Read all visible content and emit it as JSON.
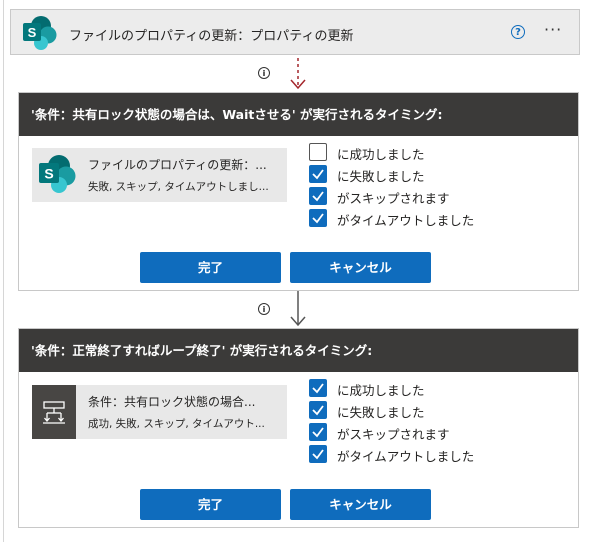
{
  "action": {
    "title": "ファイルのプロパティの更新：プロパティの更新",
    "help_glyph": "?",
    "more_glyph": "···",
    "icon": "sharepoint-icon"
  },
  "info_glyph": "i",
  "panels": [
    {
      "header": "'条件：共有ロック状態の場合は、Waitさせる' が実行されるタイミング:",
      "source": {
        "icon": "sharepoint-icon",
        "name": "ファイルのプロパティの更新：...",
        "status": "失敗, スキップ, タイムアウトしまし..."
      },
      "checkboxes": [
        {
          "label": "に成功しました",
          "checked": false
        },
        {
          "label": "に失敗しました",
          "checked": true
        },
        {
          "label": "がスキップされます",
          "checked": true
        },
        {
          "label": "がタイムアウトしました",
          "checked": true
        }
      ],
      "done_label": "完了",
      "cancel_label": "キャンセル"
    },
    {
      "header": "'条件：正常終了すればループ終了' が実行されるタイミング:",
      "source": {
        "icon": "condition-icon",
        "name": "条件：共有ロック状態の場合...",
        "status": "成功, 失敗, スキップ, タイムアウト..."
      },
      "checkboxes": [
        {
          "label": "に成功しました",
          "checked": true
        },
        {
          "label": "に失敗しました",
          "checked": true
        },
        {
          "label": "がスキップされます",
          "checked": true
        },
        {
          "label": "がタイムアウトしました",
          "checked": true
        }
      ],
      "done_label": "完了",
      "cancel_label": "キャンセル"
    }
  ],
  "colors": {
    "accent": "#0f6cbd",
    "header_bg": "#3b3a39",
    "runafter_arrow": "#a4262c"
  }
}
